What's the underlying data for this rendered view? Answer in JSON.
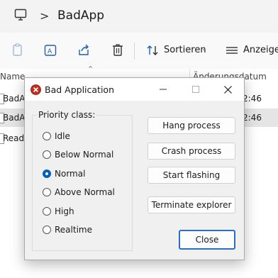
{
  "explorer": {
    "breadcrumb": {
      "icon": "monitor-icon",
      "separator": ">",
      "title": "BadApp"
    },
    "toolbar": {
      "icons": [
        "copy-icon",
        "rename-icon",
        "share-icon",
        "delete-icon"
      ],
      "sort_label": "Sortieren",
      "view_label": "Anzeigen"
    },
    "columns": {
      "name": "Name",
      "date": "Änderungsdatum"
    },
    "files": [
      {
        "name": "BadA",
        "time": "2:46",
        "selected": false
      },
      {
        "name": "BadA",
        "time": "2:46",
        "selected": true
      },
      {
        "name": "ReadM",
        "time": "2:46",
        "selected": false
      }
    ]
  },
  "dialog": {
    "title": "Bad Application",
    "icon": "error-icon",
    "group_label": "Priority class:",
    "priorities": [
      {
        "label": "Idle",
        "checked": false
      },
      {
        "label": "Below Normal",
        "checked": false
      },
      {
        "label": "Normal",
        "checked": true
      },
      {
        "label": "Above Normal",
        "checked": false
      },
      {
        "label": "High",
        "checked": false
      },
      {
        "label": "Realtime",
        "checked": false
      }
    ],
    "buttons": {
      "hang": "Hang process",
      "crash": "Crash process",
      "flash": "Start flashing",
      "terminate": "Terminate explorer",
      "close": "Close"
    }
  },
  "colors": {
    "accent": "#005fb8",
    "close_border": "#2b6cc4",
    "error_red": "#c42b1c"
  }
}
